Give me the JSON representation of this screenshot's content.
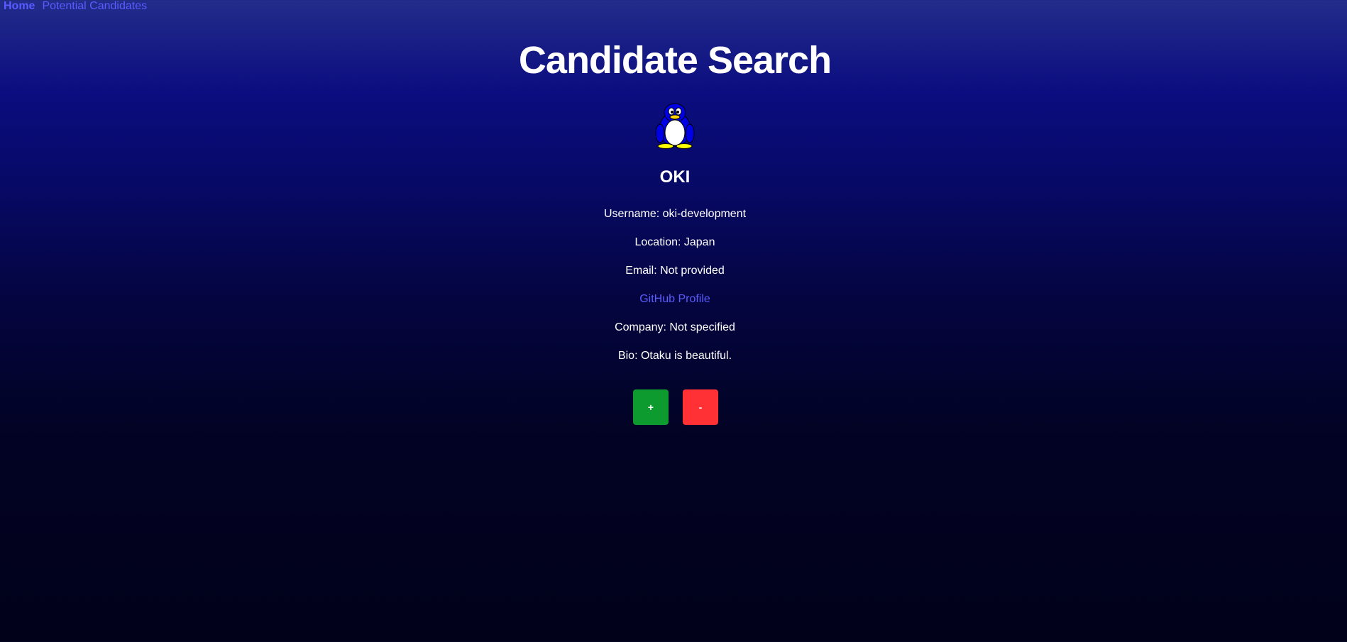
{
  "nav": {
    "home": "Home",
    "potential": "Potential Candidates"
  },
  "page": {
    "title": "Candidate Search"
  },
  "candidate": {
    "avatar_icon": "penguin-avatar-icon",
    "name": "OKI",
    "username": "Username: oki-development",
    "location": "Location: Japan",
    "email": "Email: Not provided",
    "profile_link": "GitHub Profile",
    "company": "Company: Not specified",
    "bio": "Bio: Otaku is beautiful."
  },
  "actions": {
    "accept_label": "+",
    "reject_label": "-"
  },
  "colors": {
    "link": "#5a5cff",
    "accept": "#0d9a2e",
    "reject": "#ff3135"
  }
}
